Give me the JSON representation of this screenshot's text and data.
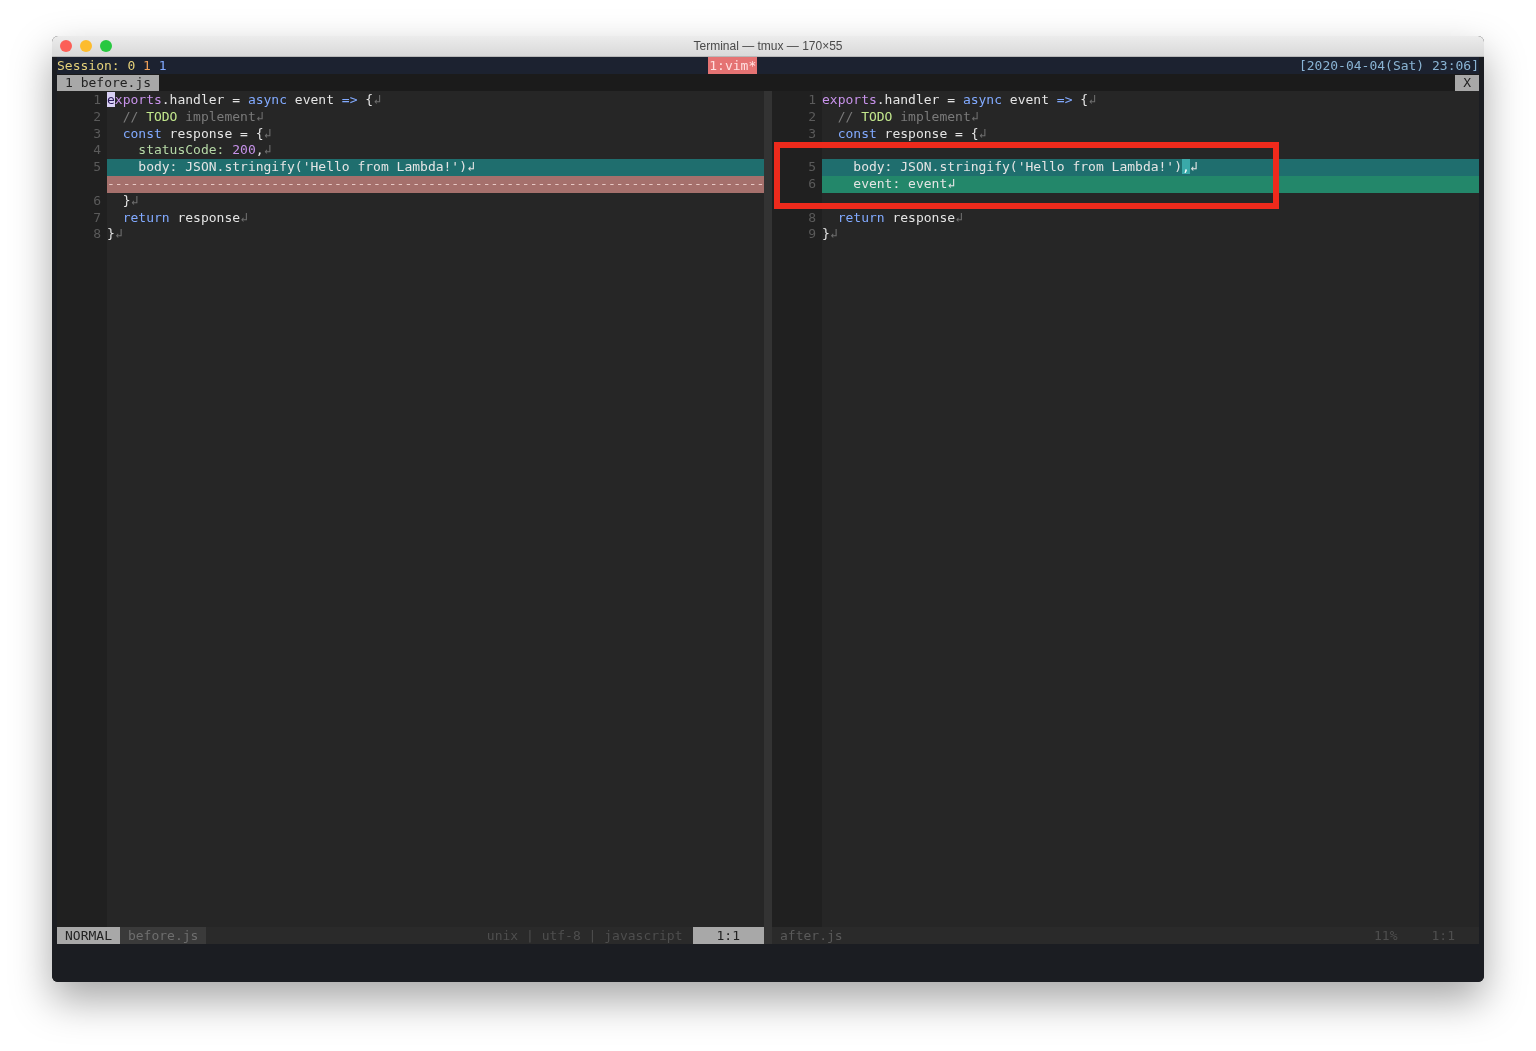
{
  "window": {
    "title": "Terminal — tmux — 170×55"
  },
  "tmux": {
    "session": [
      {
        "text": "Session:",
        "kind": "label"
      },
      {
        "text": "0",
        "kind": "yellow"
      },
      {
        "text": "1",
        "kind": "orange"
      },
      {
        "text": "1",
        "kind": "blue"
      }
    ],
    "window_tab": "1:vim*",
    "clock": "[2020-04-04(Sat) 23:06]"
  },
  "tabline": {
    "tabs": [
      {
        "label": "1 before.js",
        "selected": true
      }
    ],
    "close": "X"
  },
  "panes": [
    {
      "lines": [
        {
          "kind": "normal",
          "number": "1",
          "tokens": [
            {
              "t": "e",
              "kind": "cursor"
            },
            {
              "t": "xports",
              "kind": "purple"
            },
            {
              "t": ".handler = ",
              "kind": "plain"
            },
            {
              "t": "async",
              "kind": "blue"
            },
            {
              "t": " event ",
              "kind": "plain"
            },
            {
              "t": "=>",
              "kind": "blue"
            },
            {
              "t": " {",
              "kind": "plain"
            },
            {
              "t": "↲",
              "kind": "eol"
            }
          ]
        },
        {
          "kind": "normal",
          "number": "2",
          "tokens": [
            {
              "t": "  // ",
              "kind": "comment"
            },
            {
              "t": "TODO",
              "kind": "todo"
            },
            {
              "t": " implement",
              "kind": "comment"
            },
            {
              "t": "↲",
              "kind": "eol"
            }
          ]
        },
        {
          "kind": "normal",
          "number": "3",
          "tokens": [
            {
              "t": "  const",
              "kind": "blue"
            },
            {
              "t": " response = {",
              "kind": "plain"
            },
            {
              "t": "↲",
              "kind": "eol"
            }
          ]
        },
        {
          "kind": "normal",
          "number": "4",
          "tokens": [
            {
              "t": "    statusCode:",
              "kind": "green"
            },
            {
              "t": " 200",
              "kind": "purple"
            },
            {
              "t": ",",
              "kind": "plain"
            },
            {
              "t": "↲",
              "kind": "eol"
            }
          ]
        },
        {
          "kind": "changed",
          "number": "5",
          "tokens": [
            {
              "t": "    body: JSON.stringify('Hello from Lambda!')↲",
              "kind": "plain"
            }
          ]
        },
        {
          "kind": "filler",
          "tokens": [
            {
              "t": "------------------------------------------------------------------------------------",
              "kind": "plain"
            }
          ]
        },
        {
          "kind": "normal",
          "number": "6",
          "tokens": [
            {
              "t": "  }",
              "kind": "plain"
            },
            {
              "t": "↲",
              "kind": "eol"
            }
          ]
        },
        {
          "kind": "normal",
          "number": "7",
          "tokens": [
            {
              "t": "  return",
              "kind": "blue"
            },
            {
              "t": " response",
              "kind": "plain"
            },
            {
              "t": "↲",
              "kind": "eol"
            }
          ]
        },
        {
          "kind": "normal",
          "number": "8",
          "tokens": [
            {
              "t": "}",
              "kind": "plain"
            },
            {
              "t": "↲",
              "kind": "eol"
            }
          ]
        }
      ],
      "status": {
        "mode": "NORMAL",
        "file": "before.js",
        "info": "unix | utf-8 | javascript",
        "position": "1:1"
      }
    },
    {
      "lines": [
        {
          "kind": "normal",
          "number": "1",
          "tokens": [
            {
              "t": "exports",
              "kind": "purple"
            },
            {
              "t": ".handler = ",
              "kind": "plain"
            },
            {
              "t": "async",
              "kind": "blue"
            },
            {
              "t": " event ",
              "kind": "plain"
            },
            {
              "t": "=>",
              "kind": "blue"
            },
            {
              "t": " {",
              "kind": "plain"
            },
            {
              "t": "↲",
              "kind": "eol"
            }
          ]
        },
        {
          "kind": "normal",
          "number": "2",
          "tokens": [
            {
              "t": "  // ",
              "kind": "comment"
            },
            {
              "t": "TODO",
              "kind": "todo"
            },
            {
              "t": " implement",
              "kind": "comment"
            },
            {
              "t": "↲",
              "kind": "eol"
            }
          ]
        },
        {
          "kind": "normal",
          "number": "3",
          "tokens": [
            {
              "t": "  const",
              "kind": "blue"
            },
            {
              "t": " response = {",
              "kind": "plain"
            },
            {
              "t": "↲",
              "kind": "eol"
            }
          ]
        },
        {
          "kind": "hidden"
        },
        {
          "kind": "changed",
          "number": "5",
          "tokens": [
            {
              "t": "    body: JSON.stringify('Hello from Lambda!')",
              "kind": "plain"
            },
            {
              "t": ",",
              "kind": "diff-text"
            },
            {
              "t": "↲",
              "kind": "plain"
            }
          ]
        },
        {
          "kind": "added",
          "number": "6",
          "tokens": [
            {
              "t": "    event: event↲",
              "kind": "plain"
            }
          ]
        },
        {
          "kind": "hidden"
        },
        {
          "kind": "normal",
          "number": "8",
          "tokens": [
            {
              "t": "  return",
              "kind": "blue"
            },
            {
              "t": " response",
              "kind": "plain"
            },
            {
              "t": "↲",
              "kind": "eol"
            }
          ]
        },
        {
          "kind": "normal",
          "number": "9",
          "tokens": [
            {
              "t": "}",
              "kind": "plain"
            },
            {
              "t": "↲",
              "kind": "eol"
            }
          ]
        }
      ],
      "annotation": {
        "kind": "frame",
        "color": "#ee2a1c"
      },
      "status": {
        "file": "after.js",
        "percent": "11%",
        "position": "1:1"
      }
    }
  ]
}
